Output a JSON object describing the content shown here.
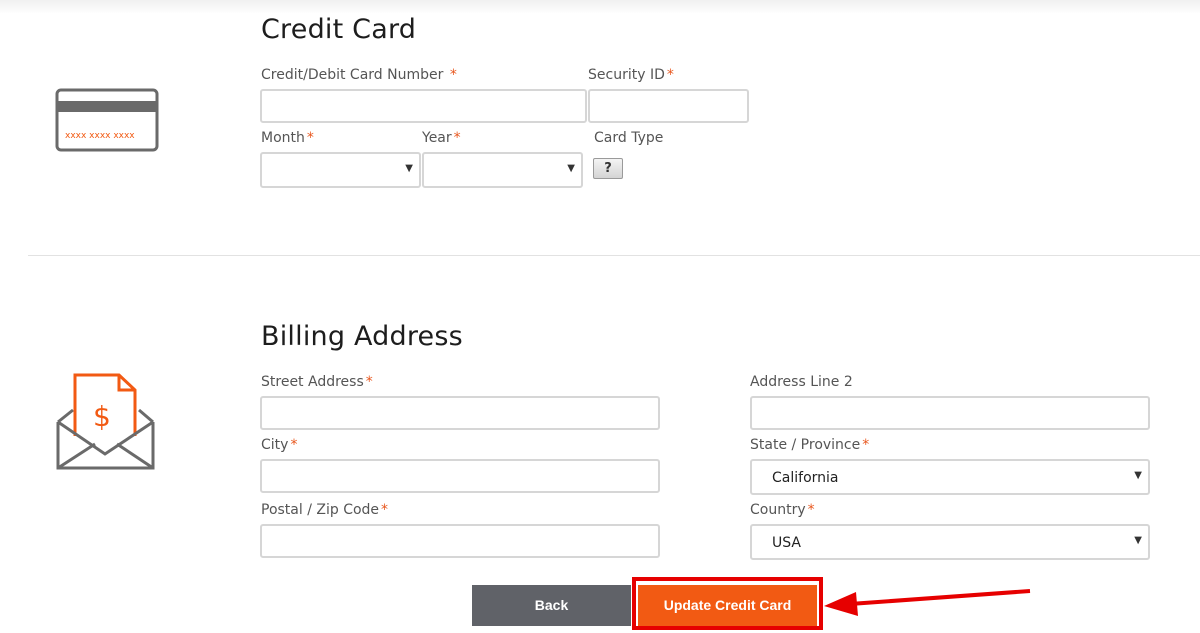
{
  "credit_card": {
    "title": "Credit Card",
    "icon_text": "xxxx xxxx xxxx",
    "card_number_label": "Credit/Debit Card Number",
    "security_id_label": "Security ID",
    "month_label": "Month",
    "year_label": "Year",
    "card_type_label": "Card Type",
    "card_type_help": "?",
    "required_mark": "*"
  },
  "billing": {
    "title": "Billing Address",
    "icon_symbol": "$",
    "street_label": "Street Address",
    "address2_label": "Address Line 2",
    "city_label": "City",
    "state_label": "State / Province",
    "state_value": "California",
    "postal_label": "Postal / Zip Code",
    "country_label": "Country",
    "country_value": "USA",
    "required_mark": "*"
  },
  "actions": {
    "back_label": "Back",
    "update_label": "Update Credit Card"
  },
  "colors": {
    "accent": "#f25a13",
    "required": "#e8571e",
    "highlight": "#e60000",
    "back_button": "#606268"
  }
}
